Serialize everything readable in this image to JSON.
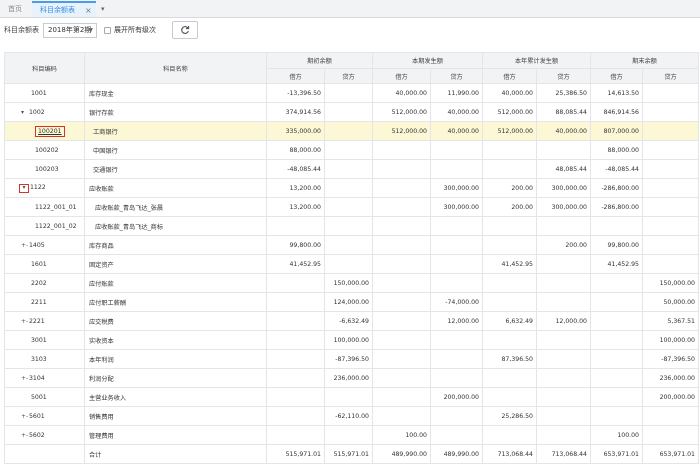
{
  "tabs": {
    "home": "首页",
    "active": "科目余额表",
    "close": "×",
    "more": "▾"
  },
  "toolbar": {
    "label": "科目余额表",
    "period": "2018年第2期",
    "show_all_levels": "展开所有级次",
    "refresh_icon": "refresh-icon"
  },
  "columns": {
    "code": "科目编码",
    "name": "科目名称",
    "opening": "期初余额",
    "current": "本期发生额",
    "ytd": "本年累计发生额",
    "closing": "期末余额",
    "debit": "借方",
    "credit": "贷方"
  },
  "rows": [
    {
      "code": "1001",
      "toggle": "",
      "name": "库存现金",
      "level": 1,
      "v": [
        "-13,396.50",
        "",
        "40,000.00",
        "11,990.00",
        "40,000.00",
        "25,386.50",
        "14,613.50",
        ""
      ]
    },
    {
      "code": "1002",
      "toggle": "▾",
      "name": "银行存款",
      "level": 1,
      "v": [
        "374,914.56",
        "",
        "512,000.00",
        "40,000.00",
        "512,000.00",
        "88,085.44",
        "846,914.56",
        ""
      ]
    },
    {
      "code": "100201",
      "toggle": "",
      "name": "工商银行",
      "level": 2,
      "selected": true,
      "boxed": true,
      "v": [
        "335,000.00",
        "",
        "512,000.00",
        "40,000.00",
        "512,000.00",
        "40,000.00",
        "807,000.00",
        ""
      ]
    },
    {
      "code": "100202",
      "toggle": "",
      "name": "中国银行",
      "level": 2,
      "v": [
        "88,000.00",
        "",
        "",
        "",
        "",
        "",
        "88,000.00",
        ""
      ]
    },
    {
      "code": "100203",
      "toggle": "",
      "name": "交通银行",
      "level": 2,
      "v": [
        "-48,085.44",
        "",
        "",
        "",
        "",
        "48,085.44",
        "-48,085.44",
        ""
      ]
    },
    {
      "code": "1122",
      "toggle": "▾",
      "toggleBoxed": true,
      "name": "应收账款",
      "level": 1,
      "v": [
        "13,200.00",
        "",
        "",
        "300,000.00",
        "200.00",
        "300,000.00",
        "-286,800.00",
        ""
      ]
    },
    {
      "code": "1122_001_01",
      "toggle": "",
      "name": "应收账款_青岛飞达_张晨",
      "level": 3,
      "v": [
        "13,200.00",
        "",
        "",
        "300,000.00",
        "200.00",
        "300,000.00",
        "-286,800.00",
        ""
      ]
    },
    {
      "code": "1122_001_02",
      "toggle": "",
      "name": "应收账款_青岛飞达_商标",
      "level": 3,
      "v": [
        "",
        "",
        "",
        "",
        "",
        "",
        "",
        ""
      ]
    },
    {
      "code": "1405",
      "toggle": "+-",
      "name": "库存商品",
      "level": 1,
      "v": [
        "99,800.00",
        "",
        "",
        "",
        "",
        "200.00",
        "99,800.00",
        ""
      ]
    },
    {
      "code": "1601",
      "toggle": "",
      "name": "固定资产",
      "level": 1,
      "v": [
        "41,452.95",
        "",
        "",
        "",
        "41,452.95",
        "",
        "41,452.95",
        ""
      ]
    },
    {
      "code": "2202",
      "toggle": "",
      "name": "应付账款",
      "level": 1,
      "v": [
        "",
        "150,000.00",
        "",
        "",
        "",
        "",
        "",
        "150,000.00"
      ]
    },
    {
      "code": "2211",
      "toggle": "",
      "name": "应付职工薪酬",
      "level": 1,
      "v": [
        "",
        "124,000.00",
        "",
        "-74,000.00",
        "",
        "",
        "",
        "50,000.00"
      ]
    },
    {
      "code": "2221",
      "toggle": "+-",
      "name": "应交税费",
      "level": 1,
      "v": [
        "",
        "-6,632.49",
        "",
        "12,000.00",
        "6,632.49",
        "12,000.00",
        "",
        "5,367.51"
      ]
    },
    {
      "code": "3001",
      "toggle": "",
      "name": "实收资本",
      "level": 1,
      "v": [
        "",
        "100,000.00",
        "",
        "",
        "",
        "",
        "",
        "100,000.00"
      ]
    },
    {
      "code": "3103",
      "toggle": "",
      "name": "本年利润",
      "level": 1,
      "v": [
        "",
        "-87,396.50",
        "",
        "",
        "87,396.50",
        "",
        "",
        "-87,396.50"
      ]
    },
    {
      "code": "3104",
      "toggle": "+-",
      "name": "利润分配",
      "level": 1,
      "v": [
        "",
        "236,000.00",
        "",
        "",
        "",
        "",
        "",
        "236,000.00"
      ]
    },
    {
      "code": "5001",
      "toggle": "",
      "name": "主营业务收入",
      "level": 1,
      "v": [
        "",
        "",
        "",
        "200,000.00",
        "",
        "",
        "",
        "200,000.00"
      ]
    },
    {
      "code": "5601",
      "toggle": "+-",
      "name": "销售费用",
      "level": 1,
      "v": [
        "",
        "-62,110.00",
        "",
        "",
        "25,286.50",
        "",
        "",
        ""
      ]
    },
    {
      "code": "5602",
      "toggle": "+-",
      "name": "管理费用",
      "level": 1,
      "v": [
        "",
        "",
        "100.00",
        "",
        "",
        "",
        "100.00",
        ""
      ]
    },
    {
      "code": "",
      "toggle": "",
      "name": "合计",
      "level": 1,
      "total": true,
      "v": [
        "515,971.01",
        "515,971.01",
        "489,990.00",
        "489,990.00",
        "713,068.44",
        "713,068.44",
        "653,971.01",
        "653,971.01"
      ]
    }
  ],
  "colors": {
    "accent": "#4a9be8",
    "highlight_row": "#fcf8d6",
    "annotation_box": "#d4332a"
  }
}
